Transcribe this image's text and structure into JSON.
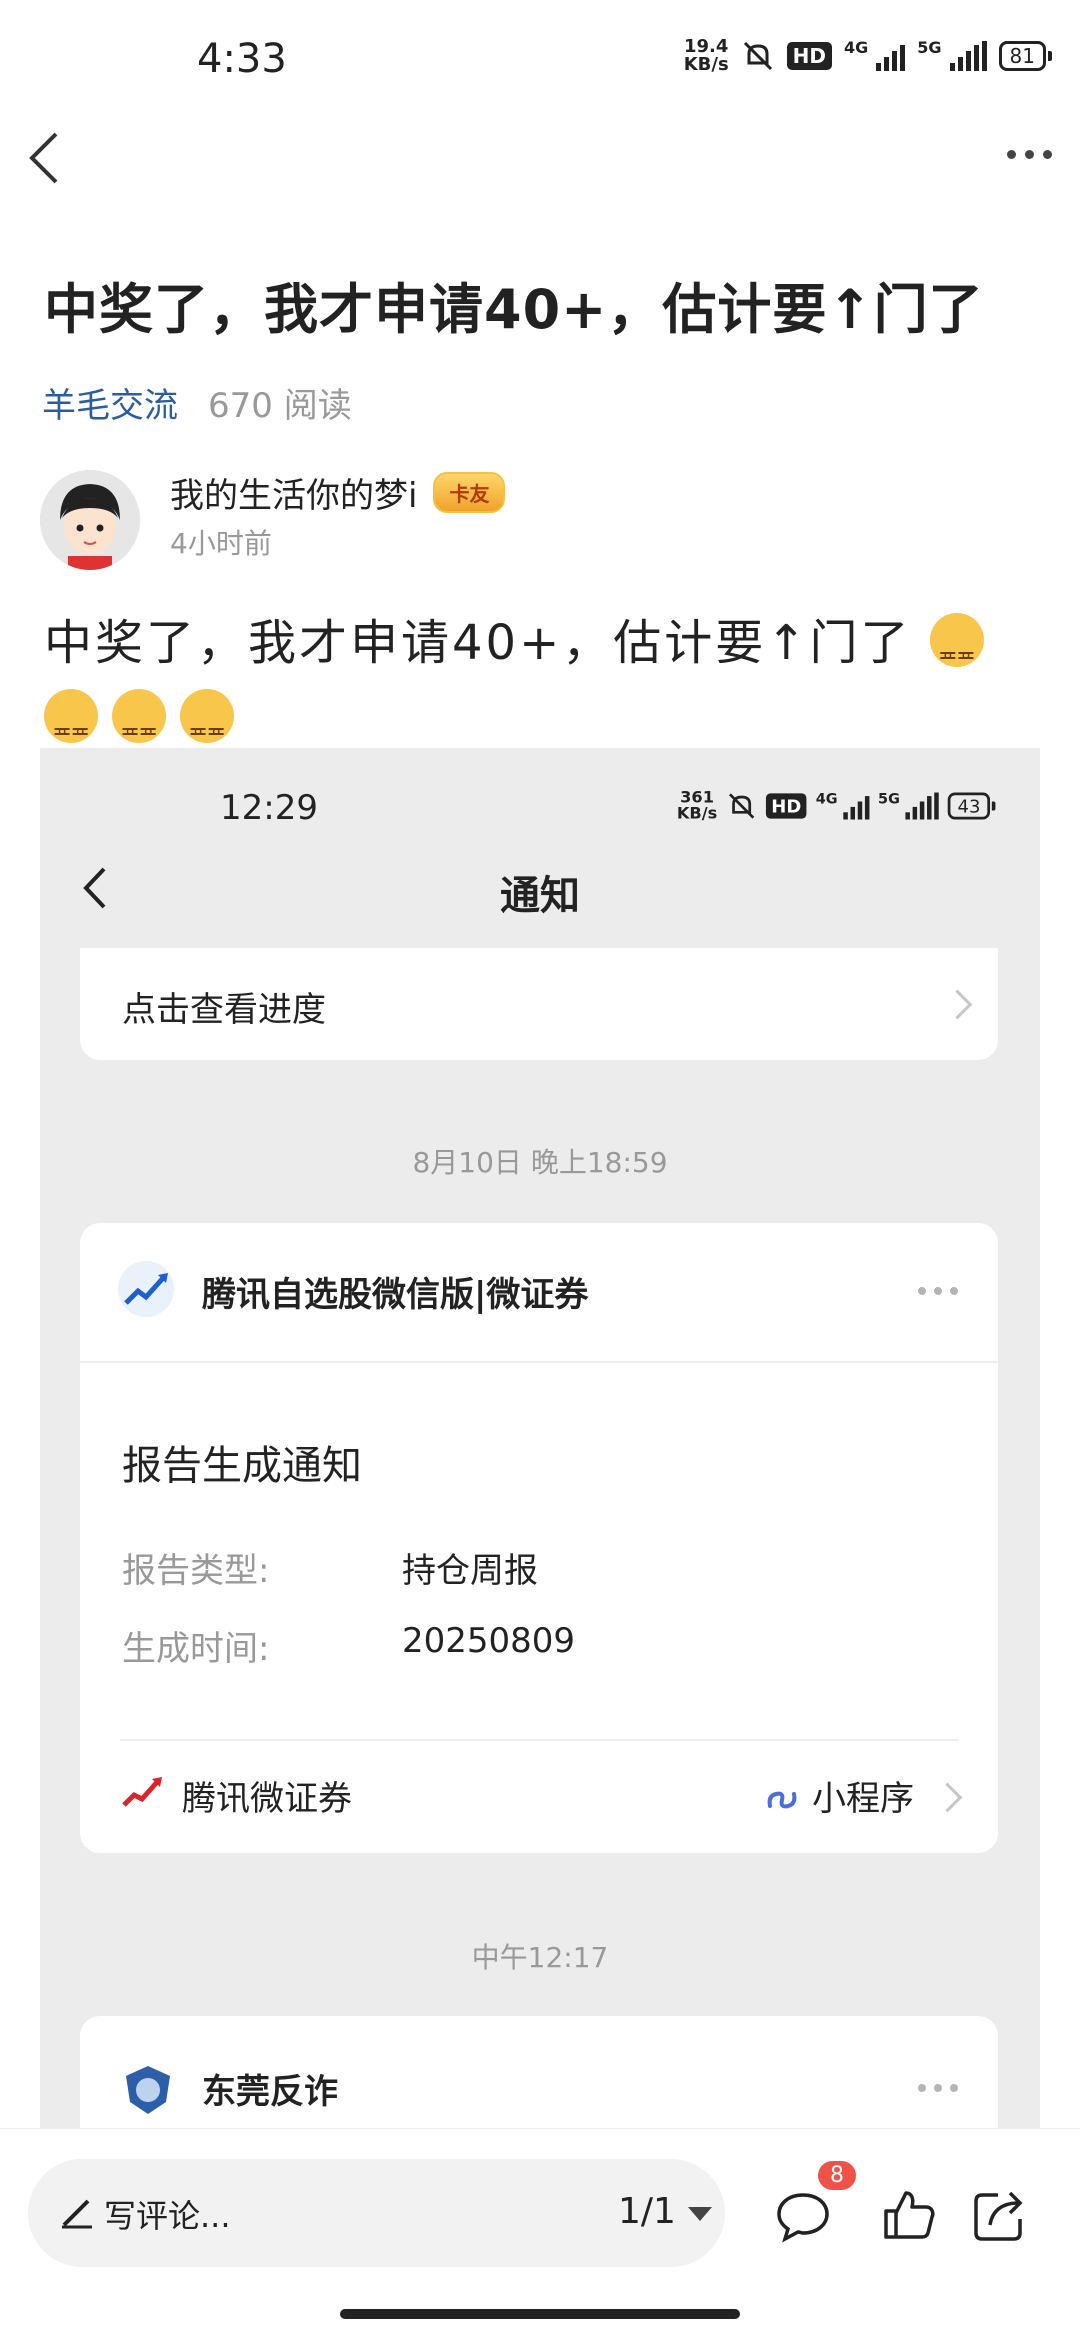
{
  "status_bar": {
    "time": "4:33",
    "speed_value": "19.4",
    "speed_unit": "KB/s",
    "hd": "HD",
    "net1": "4G",
    "net2": "5G",
    "battery": "81"
  },
  "post": {
    "title": "中奖了，我才申请40+，估计要↑门了",
    "category": "羊毛交流",
    "reads": "670 阅读",
    "author": "我的生活你的梦i",
    "badge": "卡友",
    "time_ago": "4小时前",
    "body": "中奖了，我才申请40+，估计要↑门了"
  },
  "screenshot": {
    "status_time": "12:29",
    "speed_value": "361",
    "speed_unit": "KB/s",
    "hd": "HD",
    "net1": "4G",
    "net2": "5G",
    "battery": "43",
    "page_title": "通知",
    "progress_link": "点击查看进度",
    "timestamp1": "8月10日 晚上18:59",
    "card_app": "腾讯自选股微信版|微证券",
    "card_title": "报告生成通知",
    "report_type_label": "报告类型:",
    "report_type_value": "持仓周报",
    "gen_time_label": "生成时间:",
    "gen_time_value": "20250809",
    "foot_name": "腾讯微证券",
    "mini_program": "小程序",
    "timestamp2": "中午12:17",
    "card2_app": "东莞反诈"
  },
  "bottom_bar": {
    "comment_placeholder": "写评论...",
    "page_indicator": "1/1",
    "comment_count": "8"
  }
}
